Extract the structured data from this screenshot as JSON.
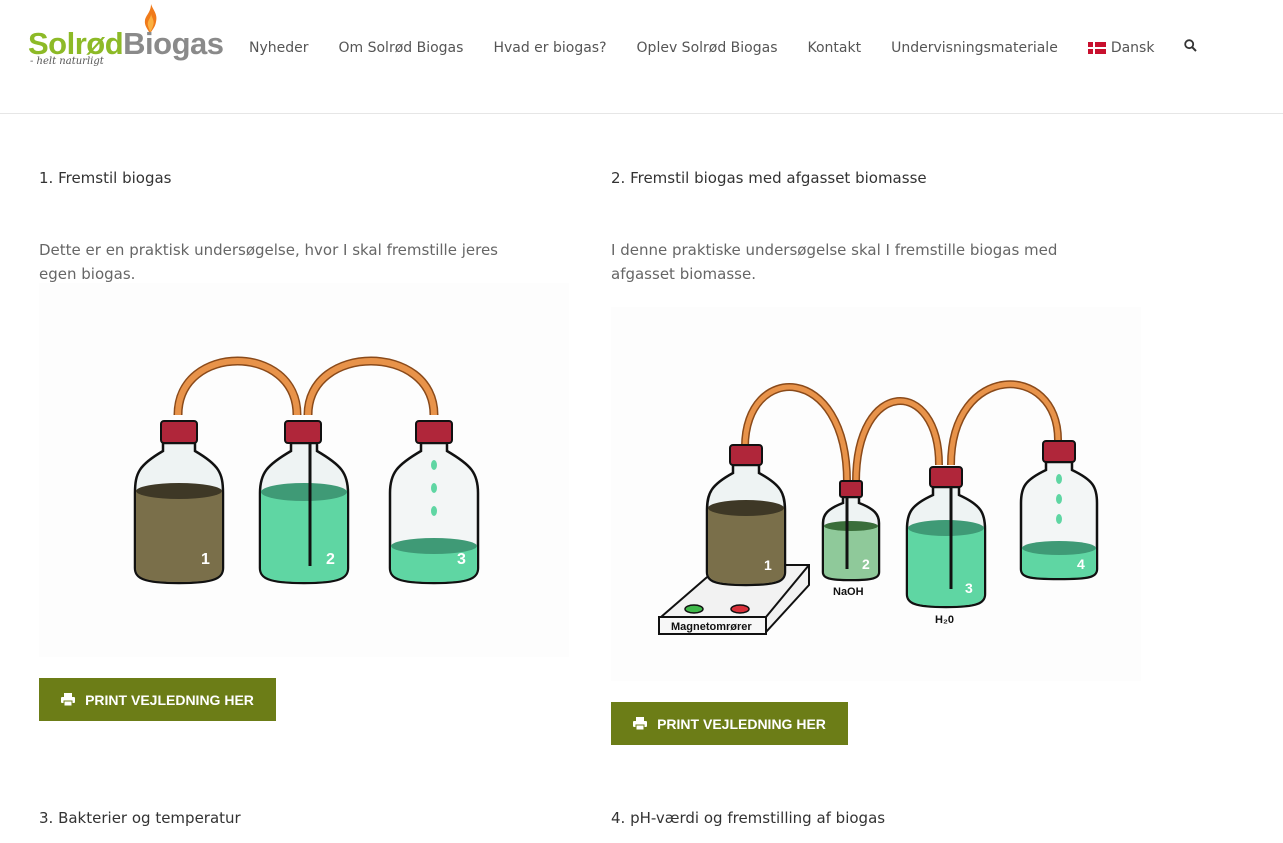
{
  "brand": {
    "name_part1": "Solrød",
    "name_part2": "Biogas",
    "tagline": "- helt naturligt",
    "green": "#8dba27",
    "gray": "#8a8a8a"
  },
  "nav": {
    "items": [
      {
        "label": "Nyheder"
      },
      {
        "label": "Om Solrød Biogas"
      },
      {
        "label": "Hvad er biogas?"
      },
      {
        "label": "Oplev Solrød Biogas"
      },
      {
        "label": "Kontakt"
      },
      {
        "label": "Undervisningsmateriale"
      }
    ],
    "language": "Dansk",
    "search_icon": "search-icon"
  },
  "experiments": [
    {
      "title": "1. Fremstil biogas",
      "description": "Dette er en praktisk undersøgelse, hvor I skal fremstille jeres egen biogas.",
      "figure_labels": [
        "1",
        "2",
        "3"
      ],
      "button": "PRINT VEJLEDNING HER"
    },
    {
      "title": "2. Fremstil biogas med afgasset biomasse",
      "description": "I denne praktiske undersøgelse skal I fremstille biogas med afgasset biomasse.",
      "figure_labels": [
        "1",
        "2",
        "3",
        "4"
      ],
      "figure_captions": [
        "NaOH",
        "H₂0",
        "Magnetomrører"
      ],
      "button": "PRINT VEJLEDNING HER"
    },
    {
      "title": "3. Bakterier og temperatur"
    },
    {
      "title": "4. pH-værdi og fremstilling af biogas"
    }
  ],
  "colors": {
    "button": "#6c7d17",
    "liquid_green": "#5fd6a3",
    "liquid_brown": "#7a6f4a",
    "tube": "#e8934a",
    "cap": "#b0263a"
  }
}
